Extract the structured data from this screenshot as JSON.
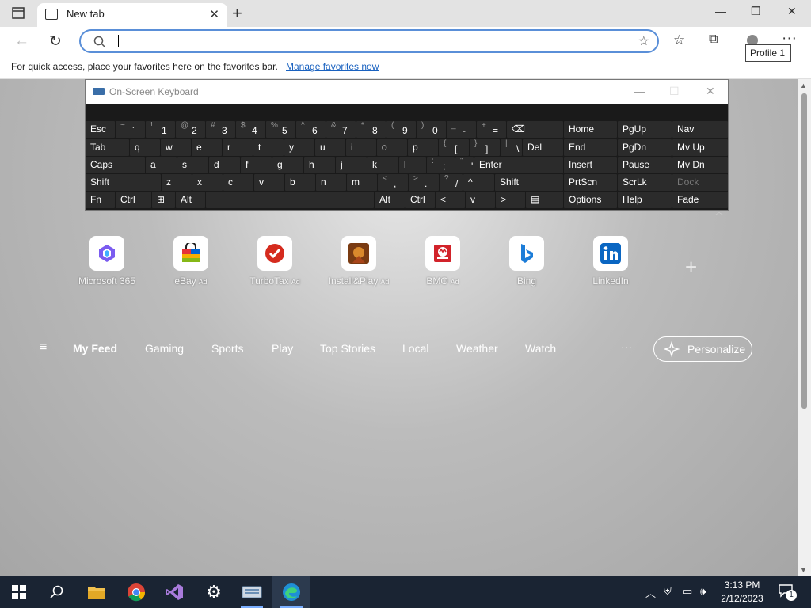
{
  "tab": {
    "title": "New tab"
  },
  "address": {
    "placeholder": ""
  },
  "favorites_bar": {
    "text": "For quick access, place your favorites here on the favorites bar.",
    "link": "Manage favorites now"
  },
  "tooltip": "Profile 1",
  "osk": {
    "title": "On-Screen Keyboard",
    "rows": [
      [
        {
          "l": "Esc"
        },
        {
          "s": "~",
          "k": "`"
        },
        {
          "s": "!",
          "k": "1"
        },
        {
          "s": "@",
          "k": "2"
        },
        {
          "s": "#",
          "k": "3"
        },
        {
          "s": "$",
          "k": "4"
        },
        {
          "s": "%",
          "k": "5"
        },
        {
          "s": "^",
          "k": "6"
        },
        {
          "s": "&",
          "k": "7"
        },
        {
          "s": "*",
          "k": "8"
        },
        {
          "s": "(",
          "k": "9"
        },
        {
          "s": ")",
          "k": "0"
        },
        {
          "s": "_",
          "k": "-"
        },
        {
          "s": "+",
          "k": "="
        },
        {
          "l": "⌫"
        },
        {
          "l": "Home"
        },
        {
          "l": "PgUp"
        },
        {
          "l": "Nav"
        }
      ],
      [
        {
          "l": "Tab"
        },
        {
          "l": "q"
        },
        {
          "l": "w"
        },
        {
          "l": "e"
        },
        {
          "l": "r"
        },
        {
          "l": "t"
        },
        {
          "l": "y"
        },
        {
          "l": "u"
        },
        {
          "l": "i"
        },
        {
          "l": "o"
        },
        {
          "l": "p"
        },
        {
          "s": "{",
          "k": "["
        },
        {
          "s": "}",
          "k": "]"
        },
        {
          "s": "|",
          "k": "\\"
        },
        {
          "l": "Del"
        },
        {
          "l": "End"
        },
        {
          "l": "PgDn"
        },
        {
          "l": "Mv Up"
        }
      ],
      [
        {
          "l": "Caps"
        },
        {
          "l": "a"
        },
        {
          "l": "s"
        },
        {
          "l": "d"
        },
        {
          "l": "f"
        },
        {
          "l": "g"
        },
        {
          "l": "h"
        },
        {
          "l": "j"
        },
        {
          "l": "k"
        },
        {
          "l": "l"
        },
        {
          "s": ":",
          "k": ";"
        },
        {
          "s": "\"",
          "k": "'"
        },
        {
          "l": "Enter"
        },
        {
          "l": "Insert"
        },
        {
          "l": "Pause"
        },
        {
          "l": "Mv Dn"
        }
      ],
      [
        {
          "l": "Shift"
        },
        {
          "l": "z"
        },
        {
          "l": "x"
        },
        {
          "l": "c"
        },
        {
          "l": "v"
        },
        {
          "l": "b"
        },
        {
          "l": "n"
        },
        {
          "l": "m"
        },
        {
          "s": "<",
          "k": ","
        },
        {
          "s": ">",
          "k": "."
        },
        {
          "s": "?",
          "k": "/"
        },
        {
          "l": "^"
        },
        {
          "l": "Shift"
        },
        {
          "l": "PrtScn"
        },
        {
          "l": "ScrLk"
        },
        {
          "l": "Dock",
          "dim": true
        }
      ],
      [
        {
          "l": "Fn"
        },
        {
          "l": "Ctrl"
        },
        {
          "l": "⊞"
        },
        {
          "l": "Alt"
        },
        {
          "l": ""
        },
        {
          "l": "Alt"
        },
        {
          "l": "Ctrl"
        },
        {
          "l": "<"
        },
        {
          "l": "v"
        },
        {
          "l": ">"
        },
        {
          "l": "▤"
        },
        {
          "l": "Options"
        },
        {
          "l": "Help"
        },
        {
          "l": "Fade"
        }
      ]
    ]
  },
  "tiles": [
    {
      "label": "Microsoft 365",
      "icon": "microsoft-365-icon",
      "ad": false
    },
    {
      "label": "eBay",
      "icon": "ebay-icon",
      "ad": true
    },
    {
      "label": "TurboTax",
      "icon": "turbotax-icon",
      "ad": true
    },
    {
      "label": "Install&Play",
      "icon": "install-play-icon",
      "ad": true
    },
    {
      "label": "BMO",
      "icon": "bmo-icon",
      "ad": true
    },
    {
      "label": "Bing",
      "icon": "bing-icon",
      "ad": false
    },
    {
      "label": "LinkedIn",
      "icon": "linkedin-icon",
      "ad": false
    }
  ],
  "ad_label": "Ad",
  "feed": {
    "items": [
      "My Feed",
      "Gaming",
      "Sports",
      "Play",
      "Top Stories",
      "Local",
      "Weather",
      "Watch"
    ],
    "more": "···",
    "personalize": "Personalize"
  },
  "clock": {
    "time": "3:13 PM",
    "date": "2/12/2023"
  },
  "notification_count": "1"
}
